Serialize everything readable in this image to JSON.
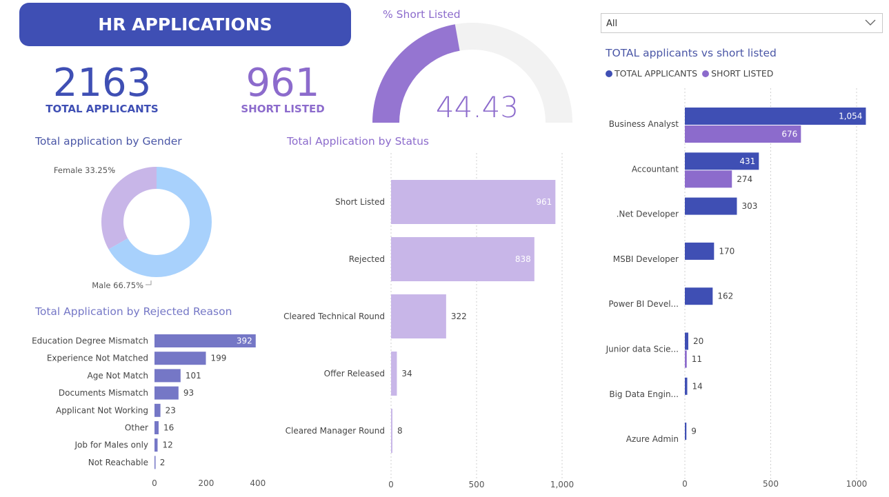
{
  "header": {
    "title": "HR APPLICATIONS"
  },
  "kpis": {
    "total": {
      "value": "2163",
      "label": "TOTAL APPLICANTS"
    },
    "short": {
      "value": "961",
      "label": "SHORT LISTED"
    }
  },
  "filter": {
    "value": "All"
  },
  "colors": {
    "blue": "#3f4fb4",
    "purple": "#8c6bcc",
    "light_purple": "#c8b6e8",
    "slate": "#7577c6",
    "light_blue": "#a8d1fc",
    "title_blue": "#4a56a6",
    "title_purple": "#8c6bcc"
  },
  "chart_data": [
    {
      "id": "gauge",
      "type": "gauge",
      "title": "% Short Listed",
      "value": 44.43,
      "display_value": "44.43",
      "range": [
        0,
        100
      ]
    },
    {
      "id": "gender",
      "type": "pie",
      "title": "Total application by Gender",
      "donut": true,
      "slices": [
        {
          "name": "Female",
          "value": 33.25,
          "label": "Female 33.25%",
          "color": "#c8b6e8"
        },
        {
          "name": "Male",
          "value": 66.75,
          "label": "Male 66.75%",
          "color": "#a8d1fc"
        }
      ]
    },
    {
      "id": "rejected",
      "type": "bar",
      "orientation": "horizontal",
      "title": "Total Application by Rejected Reason",
      "categories": [
        "Education Degree Mismatch",
        "Experience Not Matched",
        "Age Not Match",
        "Documents Mismatch",
        "Applicant Not Working",
        "Other",
        "Job for Males only",
        "Not Reachable"
      ],
      "values": [
        392,
        199,
        101,
        93,
        23,
        16,
        12,
        2
      ],
      "xlim": [
        0,
        430
      ],
      "ticks": [
        0,
        200,
        400
      ],
      "tick_labels": [
        "0",
        "200",
        "400"
      ]
    },
    {
      "id": "status",
      "type": "bar",
      "orientation": "horizontal",
      "title": "Total Application by Status",
      "categories": [
        "Short Listed",
        "Rejected",
        "Cleared Technical Round",
        "Offer Released",
        "Cleared Manager Round"
      ],
      "values": [
        961,
        838,
        322,
        34,
        8
      ],
      "xlim": [
        0,
        1000
      ],
      "ticks": [
        0,
        500,
        1000
      ],
      "tick_labels": [
        "0",
        "500",
        "1,000"
      ],
      "grid": true
    },
    {
      "id": "roles",
      "type": "bar",
      "orientation": "horizontal",
      "title": "TOTAL applicants vs short listed",
      "legend_position": "top-left",
      "categories": [
        "Business Analyst",
        "Accountant",
        ".Net Developer",
        "MSBI Developer",
        "Power BI Devel...",
        "Junior data Scie...",
        "Big Data Engin...",
        "Azure Admin"
      ],
      "series": [
        {
          "name": "TOTAL APPLICANTS",
          "color": "#3f4fb4",
          "values": [
            1054,
            431,
            303,
            170,
            162,
            20,
            14,
            9
          ]
        },
        {
          "name": "SHORT LISTED",
          "color": "#8c6bcc",
          "values": [
            676,
            274,
            null,
            null,
            null,
            11,
            null,
            null
          ]
        }
      ],
      "xlim": [
        0,
        1000
      ],
      "ticks": [
        0,
        500,
        1000
      ],
      "tick_labels": [
        "0",
        "500",
        "1000"
      ],
      "grid": true
    }
  ]
}
